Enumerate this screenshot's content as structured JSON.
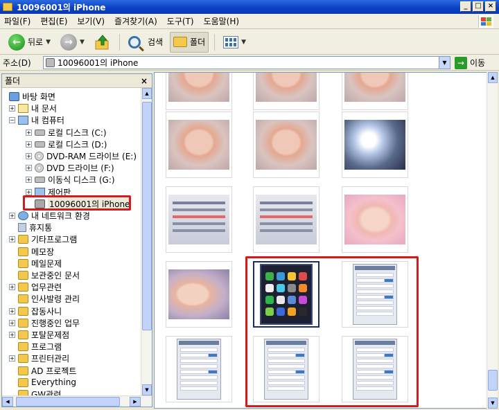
{
  "window": {
    "title": "10096001의 iPhone",
    "controls": {
      "minimize": "_",
      "maximize": "□",
      "close": "×"
    }
  },
  "menu": [
    {
      "label": "파일(F)"
    },
    {
      "label": "편집(E)"
    },
    {
      "label": "보기(V)"
    },
    {
      "label": "즐겨찾기(A)"
    },
    {
      "label": "도구(T)"
    },
    {
      "label": "도움말(H)"
    }
  ],
  "toolbar": {
    "back_label": "뒤로",
    "search_label": "검색",
    "folders_label": "폴더"
  },
  "address": {
    "label": "주소(D)",
    "value": "10096001의 iPhone",
    "go_label": "이동"
  },
  "folder_pane": {
    "title": "폴더",
    "close_glyph": "×",
    "items": [
      {
        "label": "바탕 화면",
        "icon": "desktop-icon",
        "level": 0,
        "expander": ""
      },
      {
        "label": "내 문서",
        "icon": "my-documents-icon",
        "level": 1,
        "expander": "+"
      },
      {
        "label": "내 컴퓨터",
        "icon": "my-computer-icon",
        "level": 1,
        "expander": "−"
      },
      {
        "label": "로컬 디스크 (C:)",
        "icon": "local-disk-icon",
        "level": 2,
        "expander": "+"
      },
      {
        "label": "로컬 디스크 (D:)",
        "icon": "local-disk-icon",
        "level": 2,
        "expander": "+"
      },
      {
        "label": "DVD-RAM 드라이브 (E:)",
        "icon": "dvd-ram-drive-icon",
        "level": 2,
        "expander": "+"
      },
      {
        "label": "DVD 드라이브 (F:)",
        "icon": "dvd-drive-icon",
        "level": 2,
        "expander": "+"
      },
      {
        "label": "이동식 디스크 (G:)",
        "icon": "removable-disk-icon",
        "level": 2,
        "expander": "+"
      },
      {
        "label": "제어판",
        "icon": "control-panel-icon",
        "level": 2,
        "expander": "+"
      },
      {
        "label": "10096001의 iPhone",
        "icon": "iphone-camera-icon",
        "level": 2,
        "expander": ""
      },
      {
        "label": "내 네트워크 환경",
        "icon": "network-icon",
        "level": 1,
        "expander": "+"
      },
      {
        "label": "휴지통",
        "icon": "recycle-bin-icon",
        "level": 1,
        "expander": ""
      },
      {
        "label": "기타프로그램",
        "icon": "folder-icon",
        "level": 1,
        "expander": "+"
      },
      {
        "label": "메모장",
        "icon": "folder-icon",
        "level": 1,
        "expander": ""
      },
      {
        "label": "메일문제",
        "icon": "folder-icon",
        "level": 1,
        "expander": ""
      },
      {
        "label": "보관중인 문서",
        "icon": "folder-icon",
        "level": 1,
        "expander": ""
      },
      {
        "label": "업무관련",
        "icon": "folder-icon",
        "level": 1,
        "expander": "+"
      },
      {
        "label": "인사발령 관리",
        "icon": "folder-icon",
        "level": 1,
        "expander": ""
      },
      {
        "label": "잡동사니",
        "icon": "folder-icon",
        "level": 1,
        "expander": "+"
      },
      {
        "label": "진행중인 업무",
        "icon": "folder-icon",
        "level": 1,
        "expander": "+"
      },
      {
        "label": "포탈문제점",
        "icon": "folder-icon",
        "level": 1,
        "expander": "+"
      },
      {
        "label": "프로그램",
        "icon": "folder-icon",
        "level": 1,
        "expander": ""
      },
      {
        "label": "프린터관리",
        "icon": "folder-icon",
        "level": 1,
        "expander": "+"
      },
      {
        "label": "AD 프로젝트",
        "icon": "folder-icon",
        "level": 1,
        "expander": ""
      },
      {
        "label": "Everything",
        "icon": "folder-icon",
        "level": 1,
        "expander": ""
      },
      {
        "label": "GW관련",
        "icon": "folder-icon",
        "level": 1,
        "expander": ""
      }
    ]
  },
  "thumbnails": [
    {
      "kind": "baby"
    },
    {
      "kind": "baby"
    },
    {
      "kind": "baby"
    },
    {
      "kind": "baby"
    },
    {
      "kind": "baby"
    },
    {
      "kind": "light"
    },
    {
      "kind": "paper"
    },
    {
      "kind": "paper"
    },
    {
      "kind": "pinkbaby"
    },
    {
      "kind": "baby2"
    },
    {
      "kind": "phone-home",
      "selected": true
    },
    {
      "kind": "phone-list"
    },
    {
      "kind": "phone-list"
    },
    {
      "kind": "phone-list"
    },
    {
      "kind": "phone-list"
    }
  ],
  "colors": {
    "titlebar": "#0a3fc4",
    "highlight_box": "#d41a1a",
    "folder": "#f2c94c"
  }
}
